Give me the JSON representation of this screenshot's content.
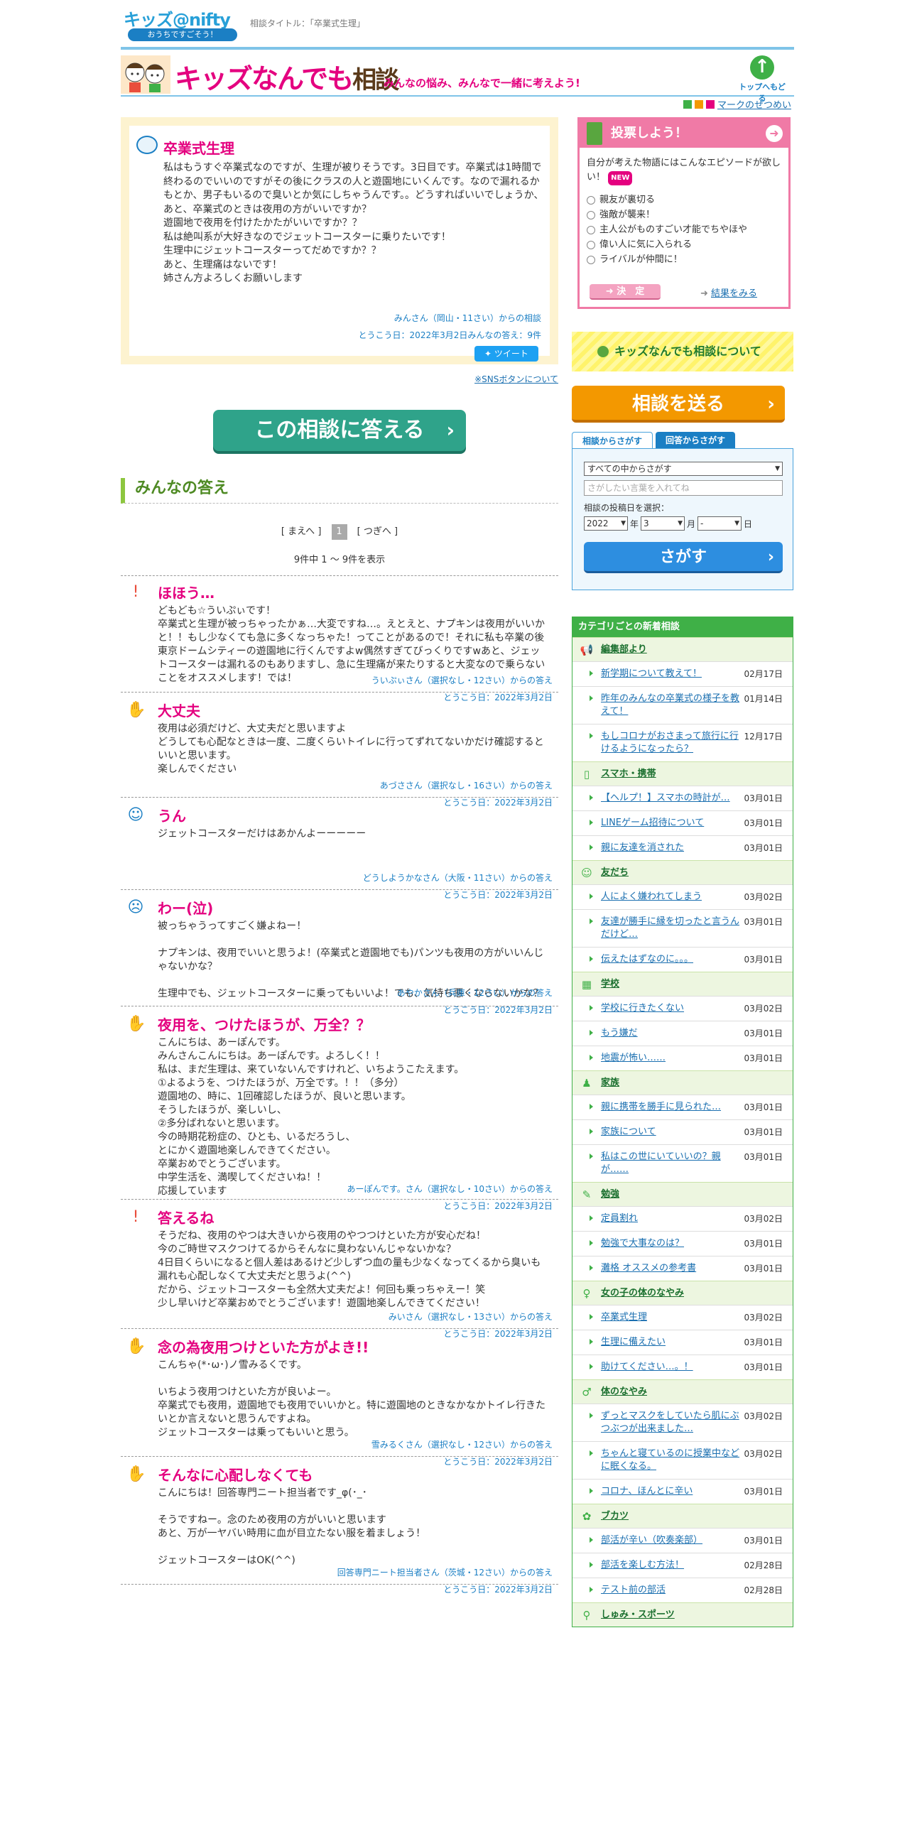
{
  "header": {
    "logo_main": "キッズ@nifty",
    "logo_sub": "おうちですごそう！",
    "crumb": "相談タイトル：「卒業式生理」",
    "banner_title": "キッズなんでも",
    "banner_title2": "相談",
    "banner_sub": "みんなの悩み、みんなで一緒に考えよう!",
    "totop": "トップへもどる",
    "mark_link": "マークのせつめい"
  },
  "question": {
    "title": "卒業式生理",
    "body": "私はもうすぐ卒業式なのですが、生理が被りそうです。3日目です。卒業式は1時間で終わるのでいいのですがその後にクラスの人と遊園地にいくんです。なので漏れるかもとか、男子もいるので臭いとか気にしちゃうんです。。どうすればいいでしょうか、\nあと、卒業式のときは夜用の方がいいですか？\n遊園地で夜用を付けたかたがいいですか？？\n私は絶叫系が大好きなのでジェットコースターに乗りたいです！\n生理中にジェットコースターってだめですか？？\nあと、生理痛はないです！\n姉さん方よろしくお願いします",
    "by": "みんさん（岡山・11さい）からの相談",
    "date": "とうこう日：2022年3月2日みんなの答え：9件",
    "tweet": "ツイート",
    "sns_note": "※SNSボタンについて"
  },
  "answer_button": "この相談に答える",
  "answers_heading": "みんなの答え",
  "pager": {
    "prev": "[ まえへ ]",
    "current": "1",
    "next": "[ つぎへ ]",
    "count": "9件中 1 ～ 9件を表示"
  },
  "answers": [
    {
      "icon": "exclamation-icon",
      "glyph": "!",
      "title": "ほほう…",
      "body": "どもども☆ういぷぃです！\n卒業式と生理が被っちゃったかぁ…大変ですね…。えとえと、ナプキンは夜用がいいかと！！もし少なくても急に多くなっちゃた！ってことがあるので！それに私も卒業の後東京ドームシティーの遊園地に行くんですよw偶然すぎてびっくりですwあと、ジェットコースターは漏れるのもありますし、急に生理痛が来たりすると大変なので乗らないことをオススメします！では！",
      "by": "ういぷぃさん（選択なし・12さい）からの答え",
      "date": "とうこう日：2022年3月2日"
    },
    {
      "icon": "hand-icon",
      "glyph": "✋",
      "title": "大丈夫",
      "body": "夜用は必須だけど、大丈夫だと思いますよ\nどうしても心配なときは一度、二度くらいトイレに行ってずれてないかだけ確認するといいと思います。\n楽しんでください",
      "by": "あづささん（選択なし・16さい）からの答え",
      "date": "とうこう日：2022年3月2日"
    },
    {
      "icon": "smile-face-icon",
      "glyph": "☺",
      "title": "うん",
      "body": "ジェットコースターだけはあかんよーーーーー",
      "by": "どうしようかなさん（大阪・11さい）からの答え",
      "date": "とうこう日：2022年3月2日"
    },
    {
      "icon": "worried-face-icon",
      "glyph": "☹",
      "title": "わー(泣)",
      "body": "被っちゃうってすごく嫌よねー！\n\nナプキンは、夜用でいいと思うよ！(卒業式と遊園地でも)パンツも夜用の方がいいんじゃないかな？\n\n生理中でも、ジェットコースターに乗ってもいいよ！でも、気持ち悪くならないかな？",
      "by": "あやかさん（兵庫・12さい）からの答え",
      "date": "とうこう日：2022年3月2日"
    },
    {
      "icon": "hand-icon",
      "glyph": "✋",
      "title": "夜用を、つけたほうが、万全？？",
      "body": "こんにちは、あーぽんです。\nみんさんこんにちは。あーぽんです。よろしく！！\n私は、まだ生理は、来ていないんですけれど、いちようこたえます。\n①よるようを、つけたほうが、万全です。！！（多分）\n遊園地の、時に、1回確認したほうが、良いと思います。\nそうしたほうが、楽しいし、\n②多分ばれないと思います。\n今の時期花粉症の、ひとも、いるだろうし、\nとにかく遊園地楽しんできてください。\n卒業おめでとうございます。\n中学生活を、満喫してくださいね！！\n応援しています",
      "by": "あーぽんです。さん（選択なし・10さい）からの答え",
      "date": "とうこう日：2022年3月2日"
    },
    {
      "icon": "exclamation-icon",
      "glyph": "!",
      "title": "答えるね",
      "body": "そうだね、夜用のやつは大きいから夜用のやつつけといた方が安心だね！\n今のご時世マスクつけてるからそんなに臭わないんじゃないかな？\n4日目くらいになると個人差はあるけど少しずつ血の量も少なくなってくるから臭いも漏れも心配しなくて大丈夫だと思うよ(^^)\nだから、ジェットコースターも全然大丈夫だよ！何回も乗っちゃえー！笑\n少し早いけど卒業おめでとうございます！遊園地楽しんできてください！",
      "by": "みいさん（選択なし・13さい）からの答え",
      "date": "とうこう日：2022年3月2日"
    },
    {
      "icon": "hand-icon",
      "glyph": "✋",
      "title": "念の為夜用つけといた方がよき!!",
      "body": "こんちゃ(*･ω･)ノ雪みるくです。\n\nいちよう夜用つけといた方が良いよー。\n卒業式でも夜用，遊園地でも夜用でいいかと。特に遊園地のときなかなかトイレ行きたいとか言えないと思うんですよね。\nジェットコースターは乗ってもいいと思う。",
      "by": "雪みるくさん（選択なし・12さい）からの答え",
      "date": "とうこう日：2022年3月2日"
    },
    {
      "icon": "hand-icon",
      "glyph": "✋",
      "title": "そんなに心配しなくても",
      "body": "こんにちは！回答専門ニート担当者です_φ(･_･\n\nそうですねー。念のため夜用の方がいいと思います\nあと、万が一ヤバい時用に血が目立たない服を着ましょう！\n\nジェットコースターはOK(^^)",
      "by": "回答専門ニート担当者さん（茨城・12さい）からの答え",
      "date": "とうこう日：2022年3月2日"
    }
  ],
  "vote": {
    "title": "投票しよう！",
    "question": "自分が考えた物語にはこんなエピソードが欲しい！",
    "new": "NEW",
    "options": [
      "親友が裏切る",
      "強敵が襲来！",
      "主人公がものすごい才能でちやほや",
      "偉い人に気に入られる",
      "ライバルが仲間に！"
    ],
    "submit": "決　定",
    "results": "結果をみる"
  },
  "about": "キッズなんでも相談について",
  "send_button": "相談を送る",
  "search": {
    "tab1": "相談からさがす",
    "tab2": "回答からさがす",
    "scope": "すべての中からさがす",
    "placeholder": "さがしたい言葉を入れてね",
    "date_label": "相談の投稿日を選択：",
    "year": "2022",
    "year_unit": "年",
    "month": "3",
    "month_unit": "月",
    "day": "-",
    "day_unit": "日",
    "button": "さがす"
  },
  "categories": {
    "title": "カテゴリごとの新着相談",
    "sections": [
      {
        "name": "編集部より",
        "icon": "megaphone-icon",
        "glyph": "📢",
        "items": [
          {
            "t": "新学期について教えて！",
            "d": "02月17日"
          },
          {
            "t": "昨年のみんなの卒業式の様子を教えて！",
            "d": "01月14日"
          },
          {
            "t": "もしコロナがおさまって旅行に行けるようになったら？",
            "d": "12月17日"
          }
        ]
      },
      {
        "name": "スマホ・携帯",
        "icon": "phone-icon",
        "glyph": "▯",
        "items": [
          {
            "t": "【ヘルプ！】スマホの時計が…",
            "d": "03月01日"
          },
          {
            "t": "LINEゲーム招待について",
            "d": "03月01日"
          },
          {
            "t": "親に友達を消された",
            "d": "03月01日"
          }
        ]
      },
      {
        "name": "友だち",
        "icon": "smile-icon",
        "glyph": "☺",
        "items": [
          {
            "t": "人によく嫌われてしまう",
            "d": "03月02日"
          },
          {
            "t": "友達が勝手に縁を切ったと言うんだけど…",
            "d": "03月01日"
          },
          {
            "t": "伝えたはずなのに。。。",
            "d": "03月01日"
          }
        ]
      },
      {
        "name": "学校",
        "icon": "school-icon",
        "glyph": "▦",
        "items": [
          {
            "t": "学校に行きたくない",
            "d": "03月02日"
          },
          {
            "t": "もう嫌だ",
            "d": "03月01日"
          },
          {
            "t": "地震が怖い……",
            "d": "03月01日"
          }
        ]
      },
      {
        "name": "家族",
        "icon": "family-icon",
        "glyph": "♟",
        "items": [
          {
            "t": "親に携帯を勝手に見られた…",
            "d": "03月01日"
          },
          {
            "t": "家族について",
            "d": "03月01日"
          },
          {
            "t": "私はこの世にいていいの？親が……",
            "d": "03月01日"
          }
        ]
      },
      {
        "name": "勉強",
        "icon": "pencil-icon",
        "glyph": "✎",
        "items": [
          {
            "t": "定員割れ",
            "d": "03月02日"
          },
          {
            "t": "勉強で大事なのは？",
            "d": "03月01日"
          },
          {
            "t": "灘格 オススメの参考書",
            "d": "03月01日"
          }
        ]
      },
      {
        "name": "女の子の体のなやみ",
        "icon": "girl-icon",
        "glyph": "♀",
        "items": [
          {
            "t": "卒業式生理",
            "d": "03月02日"
          },
          {
            "t": "生理に備えたい",
            "d": "03月01日"
          },
          {
            "t": "助けてください…。！",
            "d": "03月01日"
          }
        ]
      },
      {
        "name": "体のなやみ",
        "icon": "body-icon",
        "glyph": "♂",
        "items": [
          {
            "t": "ずっとマスクをしていたら肌にぶつぶつが出来ました…",
            "d": "03月02日"
          },
          {
            "t": "ちゃんと寝ているのに授業中などに眠くなる。",
            "d": "03月02日"
          },
          {
            "t": "コロナ、ほんとに辛い",
            "d": "03月01日"
          }
        ]
      },
      {
        "name": "ブカツ",
        "icon": "club-icon",
        "glyph": "✿",
        "items": [
          {
            "t": "部活が辛い（吹奏楽部）",
            "d": "03月01日"
          },
          {
            "t": "部活を楽しむ方法！",
            "d": "02月28日"
          },
          {
            "t": "テスト前の部活",
            "d": "02月28日"
          }
        ]
      },
      {
        "name": "しゅみ・スポーツ",
        "icon": "racket-icon",
        "glyph": "⚲",
        "items": []
      }
    ]
  }
}
